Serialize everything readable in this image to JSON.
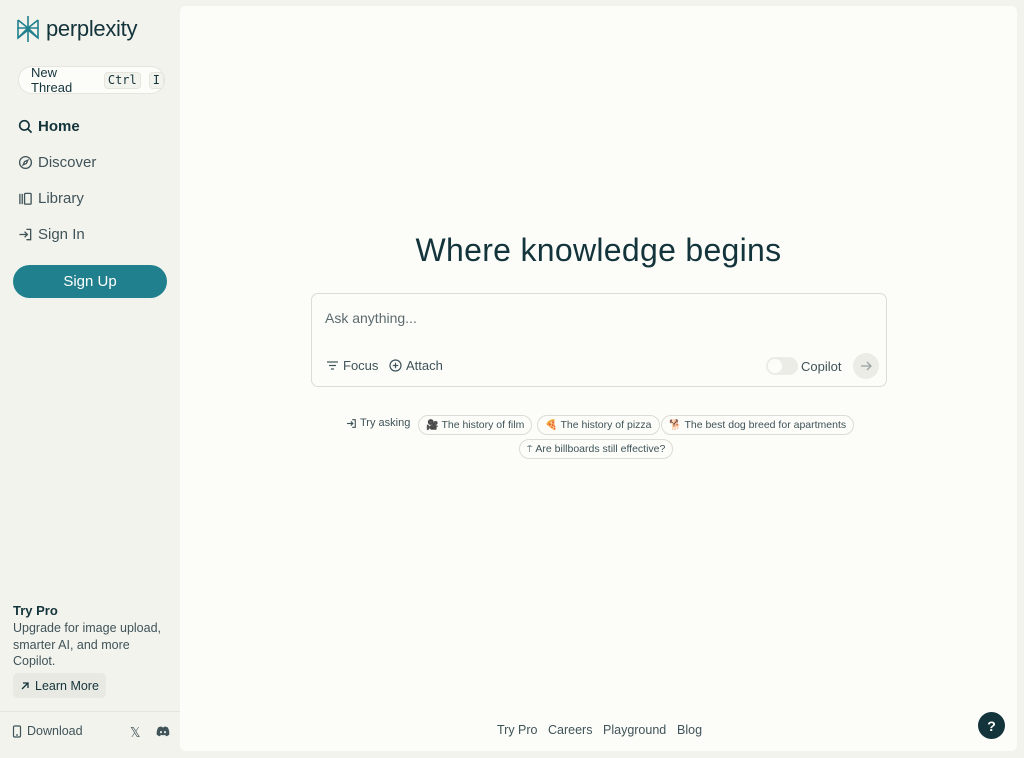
{
  "brand": {
    "name": "perplexity",
    "color": "#20808d"
  },
  "sidebar": {
    "new_thread": {
      "label": "New Thread",
      "key1": "Ctrl",
      "key2": "I"
    },
    "items": [
      {
        "label": "Home",
        "icon": "search-icon"
      },
      {
        "label": "Discover",
        "icon": "compass-icon"
      },
      {
        "label": "Library",
        "icon": "library-icon"
      },
      {
        "label": "Sign In",
        "icon": "sign-in-icon"
      }
    ],
    "signup_label": "Sign Up",
    "pro": {
      "title": "Try Pro",
      "description": "Upgrade for image upload, smarter AI, and more Copilot.",
      "learn_more": "Learn More"
    },
    "download_label": "Download"
  },
  "main": {
    "headline": "Where knowledge begins",
    "search": {
      "placeholder": "Ask anything...",
      "value": "",
      "focus_label": "Focus",
      "attach_label": "Attach",
      "copilot_label": "Copilot",
      "copilot_enabled": false
    },
    "try_asking": {
      "label": "Try asking",
      "suggestions": [
        {
          "text": "The history of film",
          "icon": "film-icon"
        },
        {
          "text": "The history of pizza",
          "icon": "pizza-icon"
        },
        {
          "text": "The best dog breed for apartments",
          "icon": "dog-icon"
        },
        {
          "text": "Are billboards still effective?",
          "icon": "billboard-icon"
        }
      ]
    }
  },
  "footer": {
    "links": [
      "Try Pro",
      "Careers",
      "Playground",
      "Blog"
    ],
    "help": "?"
  }
}
